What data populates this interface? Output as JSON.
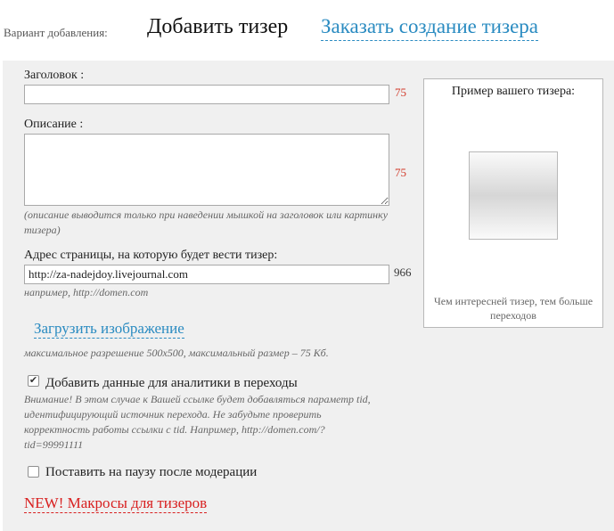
{
  "header": {
    "variant_label": "Вариант добавления:",
    "tab_add": "Добавить тизер",
    "tab_order": "Заказать создание тизера"
  },
  "form": {
    "title": {
      "label": "Заголовок :",
      "value": "",
      "counter": "75"
    },
    "description": {
      "label": "Описание :",
      "value": "",
      "counter": "75",
      "hint": "(описание выводится только при наведении мышкой на заголовок или картинку тизера)"
    },
    "url": {
      "label": "Адрес страницы, на которую будет вести тизер:",
      "value": "http://za-nadejdoy.livejournal.com",
      "counter": "966",
      "hint": "например, http://domen.com"
    },
    "upload": {
      "link": "Загрузить изображение",
      "hint": "максимальное разрешение 500x500, максимальный размер – 75 Кб."
    },
    "analytics": {
      "checked": true,
      "check_mark": "✔",
      "label": "Добавить данные для аналитики в переходы",
      "hint": "Внимание! В этом случае к Вашей ссылке будет добавляться параметр tid, идентифицирующий источник перехода. Не забудьте проверить корректность работы ссылки с tid. Например, http://domen.com/?tid=99991111"
    },
    "pause": {
      "checked": false,
      "label": "Поставить на паузу после модерации"
    },
    "macros_link": "NEW! Макросы для тизеров"
  },
  "preview": {
    "title": "Пример вашего тизера:",
    "caption": "Чем интересней тизер, тем больше переходов"
  },
  "colors": {
    "link": "#2a8bc1",
    "counter": "#d23a2a",
    "new_link": "#d81f1f",
    "panel_bg": "#f0f0f0"
  }
}
